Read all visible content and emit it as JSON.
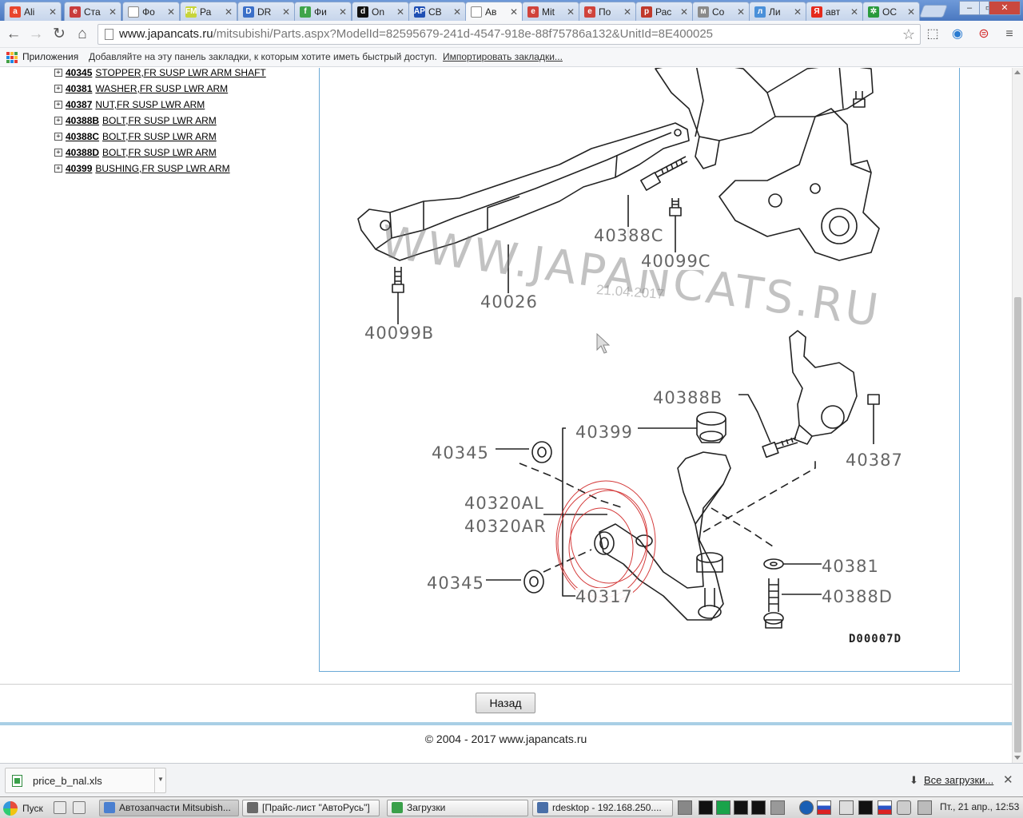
{
  "browser": {
    "tabs": [
      {
        "label": "Ali",
        "color": "#e8452c",
        "glyph": "a"
      },
      {
        "label": "Ста",
        "color": "#c83c3c",
        "glyph": "e"
      },
      {
        "label": "Фо",
        "color": "#ffffff",
        "glyph": ""
      },
      {
        "label": "Ра",
        "color": "#c7d43a",
        "glyph": "FM"
      },
      {
        "label": "DR",
        "color": "#3a6fc8",
        "glyph": "D"
      },
      {
        "label": "Фи",
        "color": "#3fa44a",
        "glyph": "f"
      },
      {
        "label": "On",
        "color": "#111111",
        "glyph": "d"
      },
      {
        "label": "СВ",
        "color": "#1f4fb3",
        "glyph": "AP"
      },
      {
        "label": "Ав",
        "color": "#ffffff",
        "glyph": ""
      },
      {
        "label": "Mit",
        "color": "#d0433b",
        "glyph": "e"
      },
      {
        "label": "По",
        "color": "#d0433b",
        "glyph": "e"
      },
      {
        "label": "Рас",
        "color": "#c0392b",
        "glyph": "p"
      },
      {
        "label": "Со",
        "color": "#8a8a8a",
        "glyph": "м"
      },
      {
        "label": "Ли",
        "color": "#4a90d9",
        "glyph": "л"
      },
      {
        "label": "авт",
        "color": "#e52a1c",
        "glyph": "Я"
      },
      {
        "label": "ОС",
        "color": "#2a9a3c",
        "glyph": "✲"
      }
    ],
    "active_tab": 8,
    "window_buttons": {
      "minimize": "–",
      "maximize": "▭",
      "close": "✕"
    },
    "url_host": "www.japancats.ru",
    "url_path": "/mitsubishi/Parts.aspx?ModelId=82595679-241d-4547-918e-88f75786a132&UnitId=8E400025",
    "bookmarks": {
      "apps_label": "Приложения",
      "hint": "Добавляйте на эту панель закладки, к которым хотите иметь быстрый доступ.",
      "import_link": "Импортировать закладки..."
    }
  },
  "parts": [
    {
      "code": "40345",
      "name": "STOPPER,FR SUSP LWR ARM SHAFT"
    },
    {
      "code": "40381",
      "name": "WASHER,FR SUSP LWR ARM"
    },
    {
      "code": "40387",
      "name": "NUT,FR SUSP LWR ARM"
    },
    {
      "code": "40388B",
      "name": "BOLT,FR SUSP LWR ARM"
    },
    {
      "code": "40388C",
      "name": "BOLT,FR SUSP LWR ARM"
    },
    {
      "code": "40388D",
      "name": "BOLT,FR SUSP LWR ARM"
    },
    {
      "code": "40399",
      "name": "BUSHING,FR SUSP LWR ARM"
    }
  ],
  "diagram": {
    "callouts": {
      "c40388C": "40388C",
      "c40099C": "40099C",
      "c40026": "40026",
      "c40099B": "40099B",
      "c40388B": "40388B",
      "c40399": "40399",
      "c40345a": "40345",
      "c40387": "40387",
      "c40320AL": "40320AL",
      "c40320AR": "40320AR",
      "c40381": "40381",
      "c40345b": "40345",
      "c40317": "40317",
      "c40388D": "40388D"
    },
    "watermark": "WWW.JAPANCATS.RU",
    "date_stamp": "21.04.2017",
    "drawing_code": "D00007D"
  },
  "page": {
    "back_button": "Назад",
    "copyright": "© 2004 - 2017 www.japancats.ru"
  },
  "downloads": {
    "file_name": "price_b_nal.xls",
    "show_all": "Все загрузки..."
  },
  "taskbar": {
    "start": "Пуск",
    "tasks": [
      {
        "label": "Автозапчасти Mitsubish...",
        "color": "#4a7fd0"
      },
      {
        "label": "[Прайс-лист \"АвтоРусь\"]",
        "color": "#6a6a6a"
      },
      {
        "label": "Загрузки",
        "color": "#3aa04a"
      },
      {
        "label": "rdesktop - 192.168.250....",
        "color": "#4a6fa8"
      }
    ],
    "clock": "Пт., 21 апр., 12:53"
  }
}
